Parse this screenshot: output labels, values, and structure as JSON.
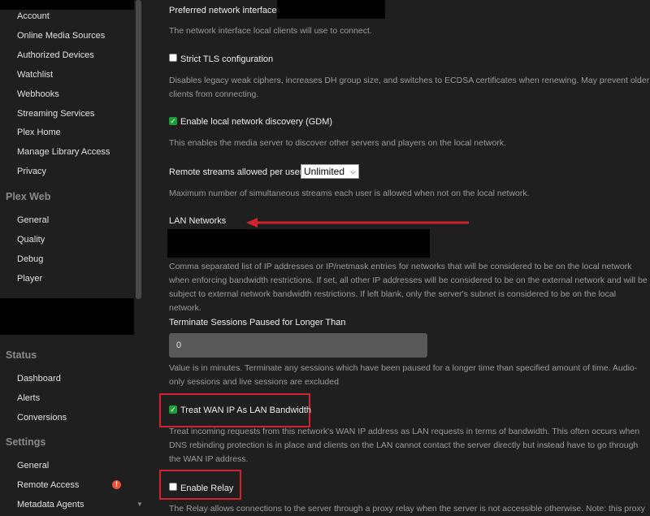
{
  "sidebar": {
    "items_top": [
      "Account",
      "Online Media Sources",
      "Authorized Devices",
      "Watchlist",
      "Webhooks",
      "Streaming Services",
      "Plex Home",
      "Manage Library Access",
      "Privacy"
    ],
    "plex_web_header": "Plex Web",
    "plex_web_items": [
      "General",
      "Quality",
      "Debug",
      "Player"
    ],
    "status_header": "Status",
    "status_items": [
      "Dashboard",
      "Alerts",
      "Conversions"
    ],
    "settings_header": "Settings",
    "settings_items": [
      "General",
      "Remote Access",
      "Metadata Agents"
    ],
    "remote_access_warning": "!",
    "accent_red": "#d0222f"
  },
  "main": {
    "preferred_interface_label": "Preferred network interface",
    "preferred_interface_help": "The network interface local clients will use to connect.",
    "strict_tls_label": "Strict TLS configuration",
    "strict_tls_checked": false,
    "strict_tls_help": "Disables legacy weak ciphers, increases DH group size, and switches to ECDSA certificates when renewing. May prevent older clients from connecting.",
    "gdm_label": "Enable local network discovery (GDM)",
    "gdm_checked": true,
    "gdm_help": "This enables the media server to discover other servers and players on the local network.",
    "remote_streams_label": "Remote streams allowed per user",
    "remote_streams_value": "Unlimited",
    "remote_streams_help": "Maximum number of simultaneous streams each user is allowed when not on the local network.",
    "lan_networks_label": "LAN Networks",
    "lan_networks_help": "Comma separated list of IP addresses or IP/netmask entries for networks that will be considered to be on the local network when enforcing bandwidth restrictions. If set, all other IP addresses will be considered to be on the external network and will be subject to external network bandwidth restrictions. If left blank, only the server's subnet is considered to be on the local network.",
    "terminate_label": "Terminate Sessions Paused for Longer Than",
    "terminate_value": "0",
    "terminate_help": "Value is in minutes. Terminate any sessions which have been paused for a longer time than specified amount of time. Audio-only sessions and live sessions are excluded",
    "wan_lan_label": "Treat WAN IP As LAN Bandwidth",
    "wan_lan_checked": true,
    "wan_lan_help": "Treat incoming requests from this network's WAN IP address as LAN requests in terms of bandwidth. This often occurs when DNS rebinding protection is in place and clients on the LAN cannot contact the server directly but instead have to go through the WAN IP address.",
    "relay_label": "Enable Relay",
    "relay_checked": false,
    "relay_help": "The Relay allows connections to the server through a proxy relay when the server is not accessible otherwise. Note: this proxy"
  }
}
